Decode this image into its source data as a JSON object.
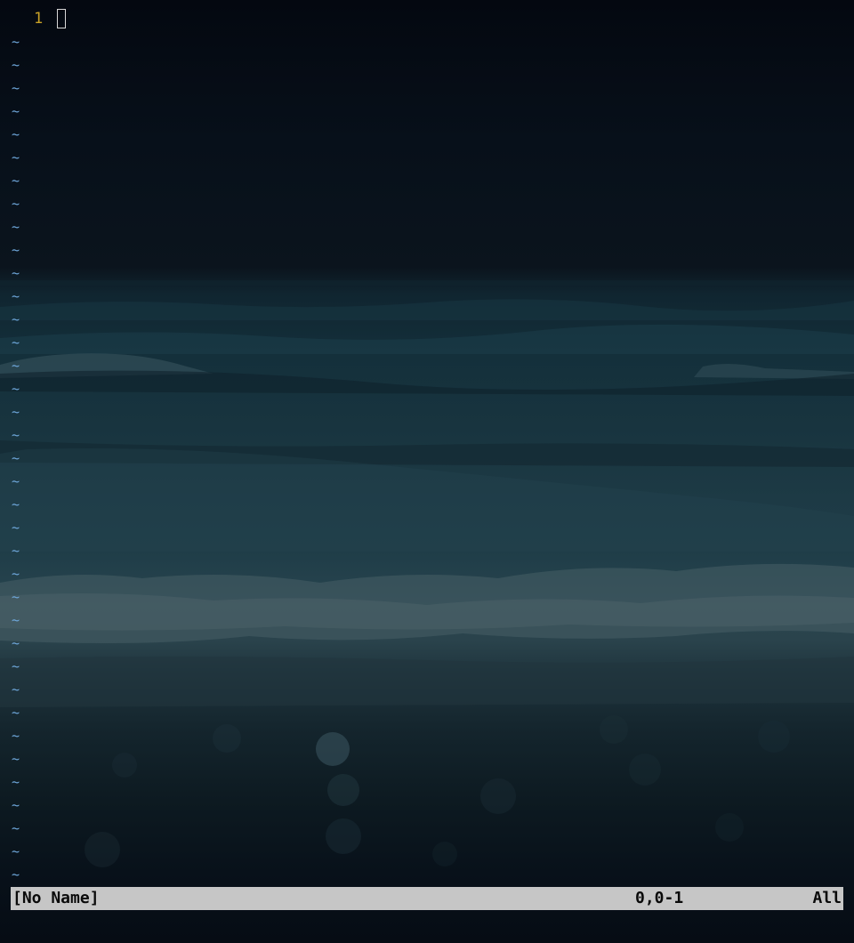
{
  "editor": {
    "first_line_number": "1",
    "empty_line_marker": "~",
    "colors": {
      "line_number": "#c9a227",
      "tilde": "#6fa8dc",
      "cursor": "#d8d8d8",
      "statusline_bg": "#c6c6c6",
      "statusline_fg": "#0a0a0a"
    }
  },
  "statusline": {
    "filename": "[No Name]",
    "position": "0,0-1",
    "scroll": "All"
  }
}
